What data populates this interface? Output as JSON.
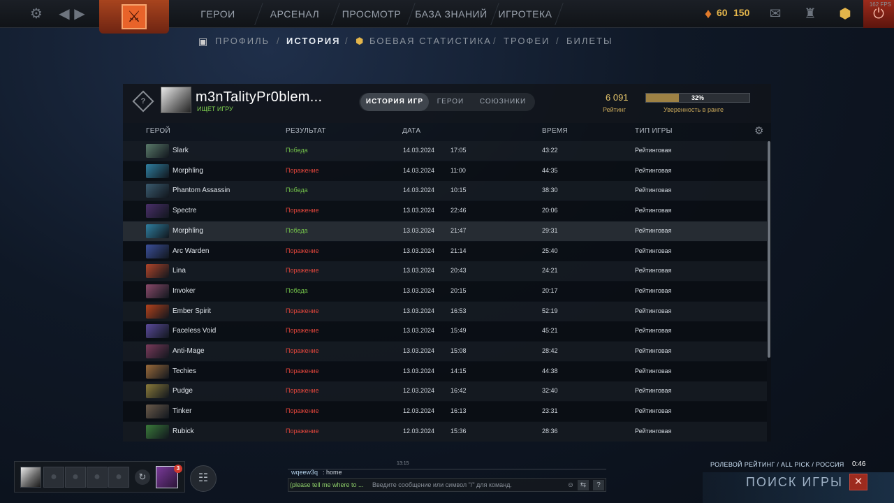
{
  "topbar": {
    "nav": [
      "ГЕРОИ",
      "АРСЕНАЛ",
      "ПРОСМОТР",
      "БАЗА ЗНАНИЙ",
      "ИГРОТЕКА"
    ],
    "gold": "60",
    "shards": "150",
    "fps": "162 FPS"
  },
  "subnav": {
    "profile": "ПРОФИЛЬ",
    "history": "ИСТОРИЯ",
    "battle_stats": "БОЕВАЯ СТАТИСТИКА",
    "trophies": "ТРОФЕИ",
    "tickets": "БИЛЕТЫ",
    "separator": "/"
  },
  "profile": {
    "rank_icon": "?",
    "name": "m3nTalityPr0blem...",
    "status": "ИЩЕТ ИГРУ",
    "tabs": [
      "ИСТОРИЯ ИГР",
      "ГЕРОИ",
      "СОЮЗНИКИ"
    ],
    "rating_value": "6 091",
    "rating_label": "Рейтинг",
    "confidence_fraction": 0.32,
    "confidence_text": "32%",
    "confidence_label": "Уверенность в ранге"
  },
  "table": {
    "columns": [
      "ГЕРОЙ",
      "РЕЗУЛЬТАТ",
      "ДАТА",
      "ВРЕМЯ",
      "ТИП ИГРЫ"
    ],
    "rows": [
      {
        "hero": "Slark",
        "result": "Победа",
        "win": true,
        "date": "14.03.2024",
        "time": "17:05",
        "duration": "43:22",
        "type": "Рейтинговая",
        "color": "#5a7a6a"
      },
      {
        "hero": "Morphling",
        "result": "Поражение",
        "win": false,
        "date": "14.03.2024",
        "time": "11:00",
        "duration": "44:35",
        "type": "Рейтинговая",
        "color": "#2f7fa0"
      },
      {
        "hero": "Phantom Assassin",
        "result": "Победа",
        "win": true,
        "date": "14.03.2024",
        "time": "10:15",
        "duration": "38:30",
        "type": "Рейтинговая",
        "color": "#3a5a6e"
      },
      {
        "hero": "Spectre",
        "result": "Поражение",
        "win": false,
        "date": "13.03.2024",
        "time": "22:46",
        "duration": "20:06",
        "type": "Рейтинговая",
        "color": "#4a2f6a"
      },
      {
        "hero": "Morphling",
        "result": "Победа",
        "win": true,
        "date": "13.03.2024",
        "time": "21:47",
        "duration": "29:31",
        "type": "Рейтинговая",
        "color": "#2f7fa0"
      },
      {
        "hero": "Arc Warden",
        "result": "Поражение",
        "win": false,
        "date": "13.03.2024",
        "time": "21:14",
        "duration": "25:40",
        "type": "Рейтинговая",
        "color": "#3b4f9a"
      },
      {
        "hero": "Lina",
        "result": "Поражение",
        "win": false,
        "date": "13.03.2024",
        "time": "20:43",
        "duration": "24:21",
        "type": "Рейтинговая",
        "color": "#b0452a"
      },
      {
        "hero": "Invoker",
        "result": "Победа",
        "win": true,
        "date": "13.03.2024",
        "time": "20:15",
        "duration": "20:17",
        "type": "Рейтинговая",
        "color": "#8a4a6a"
      },
      {
        "hero": "Ember Spirit",
        "result": "Поражение",
        "win": false,
        "date": "13.03.2024",
        "time": "16:53",
        "duration": "52:19",
        "type": "Рейтинговая",
        "color": "#b3421c"
      },
      {
        "hero": "Faceless Void",
        "result": "Поражение",
        "win": false,
        "date": "13.03.2024",
        "time": "15:49",
        "duration": "45:21",
        "type": "Рейтинговая",
        "color": "#5a4a9a"
      },
      {
        "hero": "Anti-Mage",
        "result": "Поражение",
        "win": false,
        "date": "13.03.2024",
        "time": "15:08",
        "duration": "28:42",
        "type": "Рейтинговая",
        "color": "#7a3a5a"
      },
      {
        "hero": "Techies",
        "result": "Поражение",
        "win": false,
        "date": "13.03.2024",
        "time": "14:15",
        "duration": "44:38",
        "type": "Рейтинговая",
        "color": "#9a6a3a"
      },
      {
        "hero": "Pudge",
        "result": "Поражение",
        "win": false,
        "date": "12.03.2024",
        "time": "16:42",
        "duration": "32:40",
        "type": "Рейтинговая",
        "color": "#8a7a3a"
      },
      {
        "hero": "Tinker",
        "result": "Поражение",
        "win": false,
        "date": "12.03.2024",
        "time": "16:13",
        "duration": "23:31",
        "type": "Рейтинговая",
        "color": "#6a5a4a"
      },
      {
        "hero": "Rubick",
        "result": "Поражение",
        "win": false,
        "date": "12.03.2024",
        "time": "15:36",
        "duration": "28:36",
        "type": "Рейтинговая",
        "color": "#3a7a3a"
      }
    ]
  },
  "party": {
    "badge": "3"
  },
  "chat": {
    "time": "13:15",
    "user": "wqeew3q",
    "message": ": home",
    "input_prefix": "(please tell me where to ...",
    "placeholder": "Введите сообщение или символ \"/\" для команд.",
    "help": "?"
  },
  "matchmaking": {
    "mode": "РОЛЕВОЙ РЕЙТИНГ / ALL PICK / РОССИЯ",
    "timer": "0:46",
    "search": "ПОИСК ИГРЫ",
    "cancel": "✕"
  },
  "colors": {
    "win": "#73c14a",
    "loss": "#e0453b",
    "accent": "#e6c66b"
  }
}
